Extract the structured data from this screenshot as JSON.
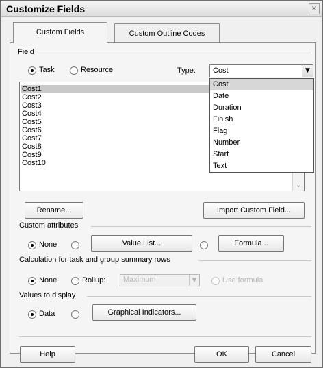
{
  "window": {
    "title": "Customize Fields",
    "close_glyph": "×"
  },
  "tabs": [
    {
      "label": "Custom Fields"
    },
    {
      "label": "Custom Outline Codes"
    }
  ],
  "field_group": {
    "label": "Field",
    "task_label": "Task",
    "resource_label": "Resource",
    "type_label": "Type:",
    "type_value": "Cost",
    "type_options": [
      "Cost",
      "Date",
      "Duration",
      "Finish",
      "Flag",
      "Number",
      "Start",
      "Text"
    ],
    "highlighted_option": "Cost"
  },
  "fields_list": [
    "Cost1",
    "Cost2",
    "Cost3",
    "Cost4",
    "Cost5",
    "Cost6",
    "Cost7",
    "Cost8",
    "Cost9",
    "Cost10"
  ],
  "buttons": {
    "rename": "Rename...",
    "import_custom_field": "Import Custom Field...",
    "value_list": "Value List...",
    "formula": "Formula...",
    "graphical_indicators": "Graphical Indicators...",
    "help": "Help",
    "ok": "OK",
    "cancel": "Cancel"
  },
  "custom_attributes": {
    "label": "Custom attributes",
    "none_label": "None"
  },
  "calculation": {
    "label": "Calculation for task and group summary rows",
    "none_label": "None",
    "rollup_label": "Rollup:",
    "rollup_value": "Maximum",
    "use_formula_label": "Use formula"
  },
  "values_to_display": {
    "label": "Values to display",
    "data_label": "Data"
  }
}
